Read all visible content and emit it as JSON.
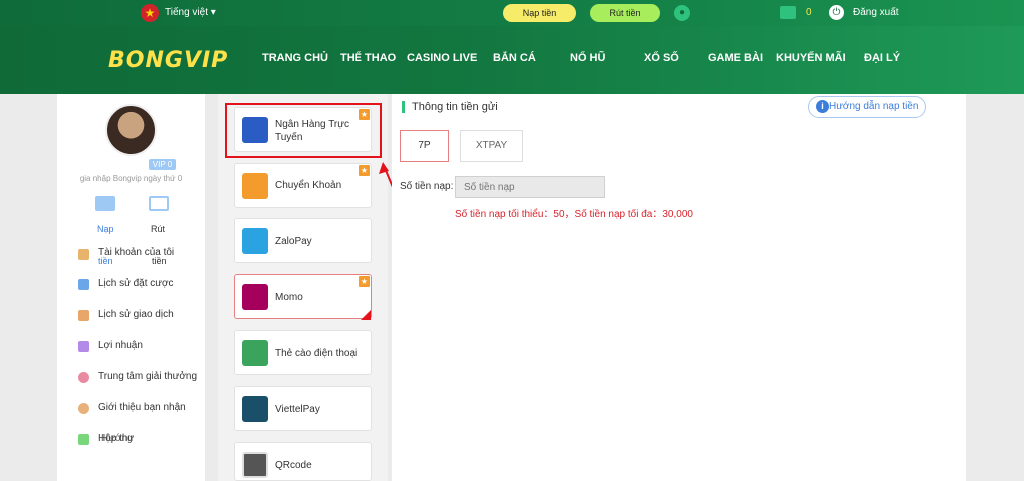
{
  "topbar": {
    "language": "Tiếng việt ▾",
    "deposit_button": "Nạp tiền",
    "withdraw_button": "Rút tiền",
    "balance": "0",
    "logout": "Đăng xuất"
  },
  "nav": {
    "logo": "BONGVIP",
    "items": [
      "TRANG CHỦ",
      "THỂ THAO",
      "CASINO LIVE",
      "BẮN CÁ",
      "NỔ HŨ",
      "XỔ SỐ",
      "GAME BÀI",
      "KHUYẾN MÃI",
      "ĐẠI LÝ"
    ]
  },
  "profile": {
    "vip": "VIP 0",
    "joined": "gia nhập Bongvip ngày thứ 0",
    "tab_deposit": "Nạp",
    "tab_withdraw": "Rút"
  },
  "menu": [
    {
      "label": "Tài khoản của tôi",
      "icon": "wallet-icon",
      "color": "#e8b36a"
    },
    {
      "label": "Lịch sử đặt cược",
      "icon": "list-icon",
      "color": "#6aa6e8"
    },
    {
      "label": "Lịch sử giao dịch",
      "icon": "receipt-icon",
      "color": "#e8a66a"
    },
    {
      "label": "Lợi nhuận",
      "icon": "chart-icon",
      "color": "#b48ae8"
    },
    {
      "label": "Trung tâm giải thưởng",
      "icon": "gift-icon",
      "color": "#e88aa0"
    },
    {
      "label": "Giới thiệu bạn nhận",
      "icon": "user-plus-icon",
      "color": "#e8b07a"
    },
    {
      "label": "Hộp thư",
      "icon": "mail-icon",
      "color": "#7ad67a"
    }
  ],
  "menu_overlaps": {
    "tien1": "tiền",
    "tien2": "tiền",
    "trong": "Hướng"
  },
  "methods": [
    {
      "label": "Ngân Hàng Trực Tuyến",
      "icon": "bank-icon",
      "color": "#2a5cc4"
    },
    {
      "label": "Chuyển Khoản",
      "icon": "transfer-icon",
      "color": "#f39b2c"
    },
    {
      "label": "ZaloPay",
      "icon": "zalopay-icon",
      "color": "#2aa3e0"
    },
    {
      "label": "Momo",
      "icon": "momo-icon",
      "color": "#a5005c"
    },
    {
      "label": "Thẻ cào điện thoại",
      "icon": "phone-card-icon",
      "color": "#3aa35c"
    },
    {
      "label": "ViettelPay",
      "icon": "viettelpay-icon",
      "color": "#1a4f6a"
    },
    {
      "label": "QRcode",
      "icon": "qrcode-icon",
      "color": "#555555"
    }
  ],
  "content": {
    "title": "Thông tin tiền gửi",
    "guide": "Hướng dẫn nạp tiền",
    "options": [
      "7P",
      "XTPAY"
    ],
    "amount_label": "Số tiền nạp:",
    "amount_placeholder": "Số tiền nạp",
    "limits": "Số tiền nạp tối thiểu：50，Số tiền nạp tối đa：30,000"
  },
  "colors": {
    "brand_green": "#12763f",
    "highlight": "#e3121b",
    "accent_blue": "#3b7ddb"
  }
}
